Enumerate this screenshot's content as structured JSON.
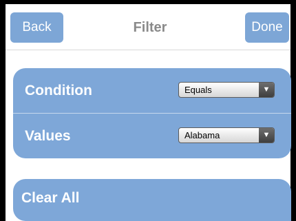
{
  "navbar": {
    "back_label": "Back",
    "title": "Filter",
    "done_label": "Done"
  },
  "filter": {
    "rows": [
      {
        "label": "Condition",
        "value": "Equals"
      },
      {
        "label": "Values",
        "value": "Alabama"
      }
    ],
    "clear_all_label": "Clear All"
  },
  "icons": {
    "dropdown": "chevron-down-icon"
  },
  "colors": {
    "accent": "#7ea7d8",
    "nav_button": "#7da6d6",
    "title": "#8a8a8a",
    "frame": "#000000"
  }
}
